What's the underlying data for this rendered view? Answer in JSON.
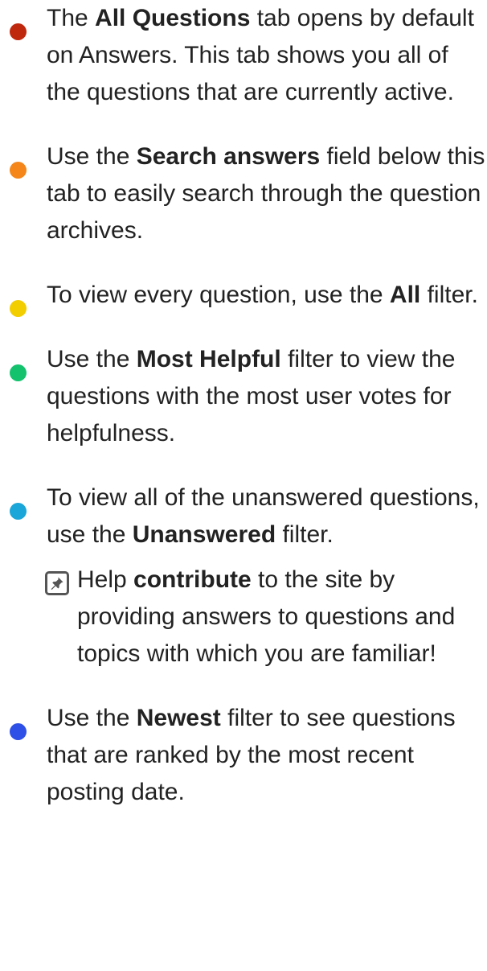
{
  "colors": {
    "red": "#c0280e",
    "orange": "#f4861a",
    "yellow": "#f2cd00",
    "green": "#14c26e",
    "cyan": "#1aa6d8",
    "blue": "#2e50e6"
  },
  "items": [
    {
      "before": "The ",
      "bold": "All Questions",
      "after": " tab opens by default on Answers. This tab shows you all of the questions that are currently active."
    },
    {
      "before": "Use the ",
      "bold": "Search answers",
      "after": " field below this tab to easily search through the question archives."
    },
    {
      "before": "To view every question, use the ",
      "bold": "All",
      "after": " filter."
    },
    {
      "before": "Use the ",
      "bold": "Most Helpful",
      "after": " filter to view the questions with the most user votes for helpfulness."
    },
    {
      "before": "To view all of the unanswered questions, use the ",
      "bold": "Unanswered",
      "after": " filter."
    },
    {
      "before": "Use the ",
      "bold": "Newest",
      "after": " filter to see questions that are ranked by the most recent posting date."
    }
  ],
  "note": {
    "icon": "pin-icon",
    "before": "Help ",
    "bold": "contribute",
    "after": " to the site by providing answers to questions and topics with which you are familiar!"
  }
}
